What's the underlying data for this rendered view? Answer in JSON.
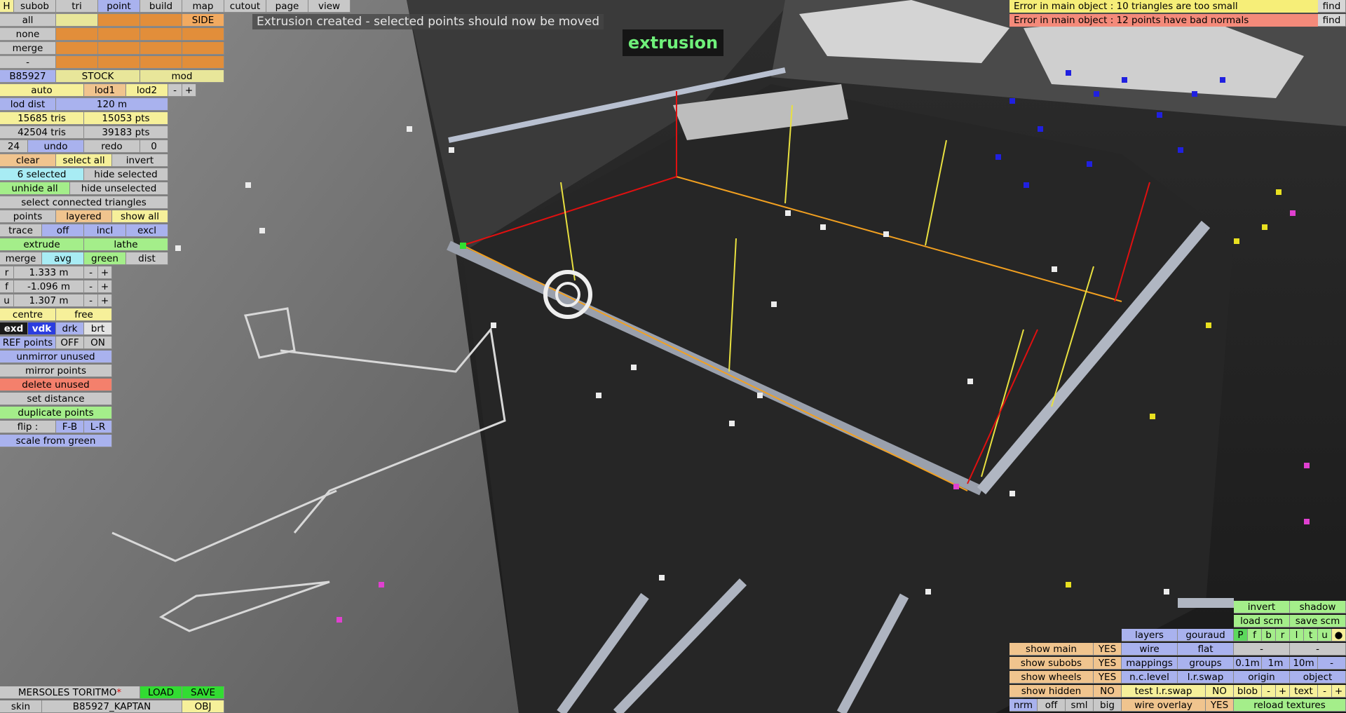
{
  "status_message": "Extrusion created - selected points should now be moved",
  "mode_label": "extrusion",
  "errors": [
    {
      "text": "Error in main object : 10 triangles are too small",
      "find": "find"
    },
    {
      "text": "Error in main object : 12 points have bad normals",
      "find": "find"
    }
  ],
  "top_tabs": {
    "h": "H",
    "subob": "subob",
    "tri": "tri",
    "point": "point",
    "build": "build",
    "map": "map",
    "cutout": "cutout",
    "page": "page",
    "view": "view"
  },
  "select_grid": {
    "all": "all",
    "none": "none",
    "merge": "merge",
    "dash": "-",
    "side": "SIDE"
  },
  "object": {
    "id": "B85927",
    "stock": "STOCK",
    "mod": "mod"
  },
  "lod": {
    "auto": "auto",
    "lod1": "lod1",
    "lod2": "lod2",
    "minus": "-",
    "plus": "+",
    "dist_label": "lod dist",
    "dist_value": "120 m"
  },
  "stats": {
    "tris1": "15685 tris",
    "pts1": "15053 pts",
    "tris2": "42504 tris",
    "pts2": "39183 pts"
  },
  "history": {
    "count": "24",
    "undo": "undo",
    "redo": "redo",
    "redo_count": "0"
  },
  "selection": {
    "clear": "clear",
    "select_all": "select all",
    "invert": "invert",
    "selected": "6 selected",
    "hide_selected": "hide selected",
    "unhide_all": "unhide all",
    "hide_unselected": "hide unselected",
    "select_connected": "select connected triangles"
  },
  "points_row": {
    "points": "points",
    "layered": "layered",
    "show_all": "show all"
  },
  "trace_row": {
    "trace": "trace",
    "off": "off",
    "incl": "incl",
    "excl": "excl"
  },
  "extrude_row": {
    "extrude": "extrude",
    "lathe": "lathe"
  },
  "merge_row": {
    "merge": "merge",
    "avg": "avg",
    "green": "green",
    "dist": "dist"
  },
  "coords": [
    {
      "axis": "r",
      "value": "1.333 m",
      "minus": "-",
      "plus": "+"
    },
    {
      "axis": "f",
      "value": "-1.096 m",
      "minus": "-",
      "plus": "+"
    },
    {
      "axis": "u",
      "value": "1.307 m",
      "minus": "-",
      "plus": "+"
    }
  ],
  "centre_row": {
    "centre": "centre",
    "free": "free"
  },
  "display_row": {
    "exd": "exd",
    "vdk": "vdk",
    "drk": "drk",
    "brt": "brt"
  },
  "ref_row": {
    "ref_points": "REF points",
    "off": "OFF",
    "on": "ON"
  },
  "actions": {
    "unmirror": "unmirror unused",
    "mirror": "mirror points",
    "delete": "delete unused",
    "set_distance": "set distance",
    "duplicate": "duplicate points",
    "flip": "flip :",
    "fb": "F-B",
    "lr": "L-R",
    "scale": "scale from green"
  },
  "bottom_left": {
    "name": "MERSOLES TORITMO",
    "asterisk": "*",
    "load": "LOAD",
    "save": "SAVE",
    "skin": "skin",
    "skin_value": "B85927_KAPTAN",
    "obj": "OBJ"
  },
  "view_panel": {
    "invert": "invert",
    "shadow": "shadow",
    "load_scm": "load scm",
    "save_scm": "save scm",
    "layers": "layers",
    "gouraud": "gouraud",
    "letters": [
      "P",
      "f",
      "b",
      "r",
      "l",
      "t",
      "u",
      "●"
    ],
    "show_main": "show main",
    "show_main_v": "YES",
    "wire": "wire",
    "flat": "flat",
    "dash": "-",
    "show_subobs": "show subobs",
    "show_subobs_v": "YES",
    "mappings": "mappings",
    "groups": "groups",
    "d01": "0.1m",
    "d1": "1m",
    "d10": "10m",
    "dm": "-",
    "show_wheels": "show wheels",
    "show_wheels_v": "YES",
    "nc_level": "n.c.level",
    "lr_swap": "l.r.swap",
    "origin": "origin",
    "object": "object",
    "show_hidden": "show hidden",
    "show_hidden_v": "NO",
    "test_lr": "test l.r.swap",
    "test_lr_v": "NO",
    "blob": "blob",
    "text": "text",
    "nrm": "nrm",
    "off": "off",
    "sml": "sml",
    "big": "big",
    "wire_overlay": "wire overlay",
    "wire_overlay_v": "YES",
    "reload": "reload textures"
  },
  "colors": {
    "orange": "#e28e3a",
    "blue": "#a9b2ee",
    "yellow": "#f6f09a",
    "green": "#a4ee8a",
    "red": "#f4806c",
    "error_yellow": "#f6ee78",
    "error_red": "#f48a7a"
  }
}
